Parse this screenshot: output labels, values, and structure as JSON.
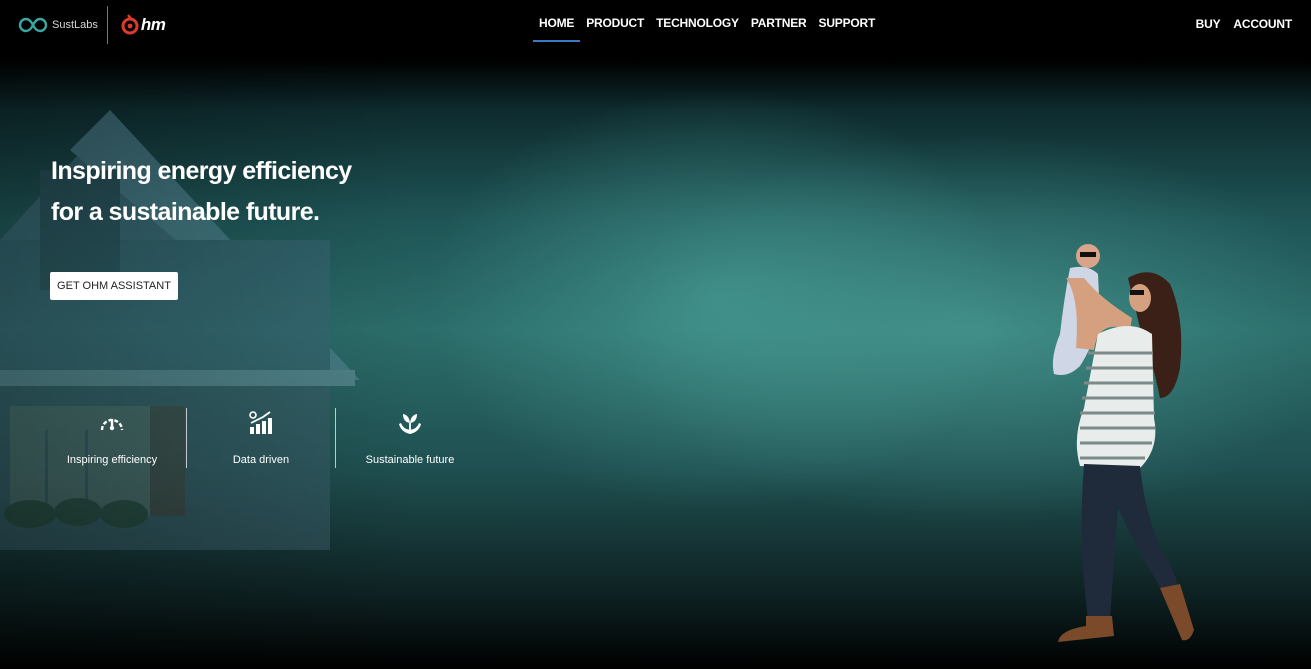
{
  "header": {
    "brand": {
      "sust_name": "SustLabs",
      "ohm_name": "hm"
    },
    "nav": [
      {
        "label": "HOME",
        "active": true
      },
      {
        "label": "PRODUCT",
        "active": false
      },
      {
        "label": "TECHNOLOGY",
        "active": false
      },
      {
        "label": "PARTNER",
        "active": false
      },
      {
        "label": "SUPPORT",
        "active": false
      }
    ],
    "right": {
      "buy": "BUY",
      "account": "ACCOUNT"
    },
    "active_color": "#3a7bbf"
  },
  "hero": {
    "headline_line1": "Inspiring energy efficiency",
    "headline_line2": "for a sustainable future.",
    "cta": "GET OHM ASSISTANT",
    "features": [
      {
        "icon": "gauge-icon",
        "label": "Inspiring efficiency"
      },
      {
        "icon": "growth-chart-icon",
        "label": "Data driven"
      },
      {
        "icon": "plant-hands-icon",
        "label": "Sustainable future"
      }
    ]
  }
}
